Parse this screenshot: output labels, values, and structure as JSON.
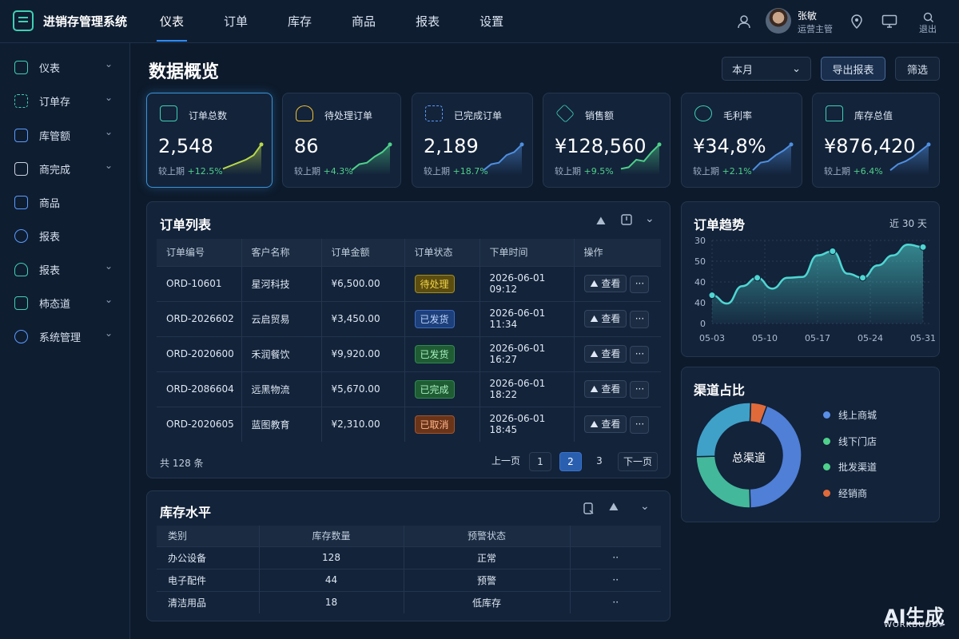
{
  "app": {
    "title": "进销存管理系统"
  },
  "nav": [
    "仪表",
    "订单",
    "库存",
    "商品",
    "报表",
    "设置"
  ],
  "user": {
    "name": "张敏",
    "role": "运营主管",
    "logout": "退出"
  },
  "sidebar": [
    {
      "label": "仪表",
      "chevron": true
    },
    {
      "label": "订单存",
      "chevron": true
    },
    {
      "label": "库管额",
      "chevron": true
    },
    {
      "label": "商完成",
      "chevron": true
    },
    {
      "label": "商品",
      "chevron": false
    },
    {
      "label": "报表",
      "chevron": false
    },
    {
      "label": "报表",
      "chevron": true
    },
    {
      "label": "柿态道",
      "chevron": true
    },
    {
      "label": "系统管理",
      "chevron": true
    }
  ],
  "page": {
    "title": "数据概览",
    "period": "本月",
    "export": "导出报表",
    "filter": "筛选"
  },
  "cards": [
    {
      "label": "订单总数",
      "value": "2,548",
      "compare": "较上期",
      "delta": "+12.5%",
      "color": "#3fd0b4",
      "spark": "#b8d94a"
    },
    {
      "label": "待处理订单",
      "value": "86",
      "compare": "较上期",
      "delta": "+4.3%",
      "color": "#f1c232",
      "spark": "#4fd18b"
    },
    {
      "label": "已完成订单",
      "value": "2,189",
      "compare": "较上期",
      "delta": "+18.7%",
      "color": "#5a9cff",
      "spark": "#4f8fe0"
    },
    {
      "label": "销售额",
      "value": "¥128,560",
      "compare": "较上期",
      "delta": "+9.5%",
      "color": "#3fd0b4",
      "spark": "#4fd18b"
    },
    {
      "label": "毛利率",
      "value": "¥34,8%",
      "compare": "较上期",
      "delta": "+2.1%",
      "color": "#3fd0b4",
      "spark": "#4f8fe0"
    },
    {
      "label": "库存总值",
      "value": "¥876,420",
      "compare": "较上期",
      "delta": "+6.4%",
      "color": "#3fd0b4",
      "spark": "#4f8fe0"
    }
  ],
  "orders": {
    "title": "订单列表",
    "columns": [
      "订单编号",
      "客户名称",
      "订单金额",
      "订单状态",
      "下单时间",
      "操作"
    ],
    "rows": [
      {
        "id": "ORD-10601",
        "customer": "星河科技",
        "amount": "¥6,500.00",
        "status": "待处理",
        "tone": "yellow",
        "time": "2026-06-01 09:12"
      },
      {
        "id": "ORD-2026602",
        "customer": "云启贸易",
        "amount": "¥3,450.00",
        "status": "已发货",
        "tone": "blue",
        "time": "2026-06-01 11:34"
      },
      {
        "id": "ORD-2020600",
        "customer": "禾润餐饮",
        "amount": "¥9,920.00",
        "status": "已发货",
        "tone": "green",
        "time": "2026-06-01 16:27"
      },
      {
        "id": "ORD-2086604",
        "customer": "远黑物流",
        "amount": "¥5,670.00",
        "status": "已完成",
        "tone": "green",
        "time": "2026-06-01 18:22"
      },
      {
        "id": "ORD-2020605",
        "customer": "蓝图教育",
        "amount": "¥2,310.00",
        "status": "已取消",
        "tone": "orange",
        "time": "2026-06-01 18:45"
      }
    ],
    "view": "查看",
    "more": "···",
    "total": "共 128 条",
    "pager": {
      "prev": "上一页",
      "pages": [
        "1",
        "2",
        "3"
      ],
      "current": "2",
      "next": "下一页"
    }
  },
  "inventory": {
    "title": "库存水平",
    "columns": [
      "类别",
      "库存数量",
      "预警状态",
      ""
    ],
    "rows": [
      {
        "category": "办公设备",
        "qty": "128",
        "status": "正常",
        "warn": false,
        "extra": "··"
      },
      {
        "category": "电子配件",
        "qty": "44",
        "status": "预警",
        "warn": true,
        "extra": "··"
      },
      {
        "category": "清洁用品",
        "qty": "18",
        "status": "低库存",
        "warn": true,
        "extra": "··"
      }
    ]
  },
  "trend": {
    "title": "订单趋势",
    "range": "近 30 天"
  },
  "chart_data": [
    {
      "type": "area",
      "title": "订单趋势",
      "x": [
        "05-03",
        "05-05",
        "05-08",
        "05-10",
        "05-12",
        "05-14",
        "05-16",
        "05-18",
        "05-20",
        "05-22",
        "05-24",
        "05-26",
        "05-28",
        "05-30",
        "05-31"
      ],
      "xticks": [
        "05-03",
        "05-10",
        "05-17",
        "05-24",
        "05-31"
      ],
      "yticks": [
        "0",
        "40",
        "40",
        "50",
        "30"
      ],
      "values": [
        0.34,
        0.24,
        0.45,
        0.55,
        0.42,
        0.55,
        0.56,
        0.82,
        0.87,
        0.6,
        0.55,
        0.7,
        0.82,
        0.95,
        0.92
      ],
      "markers": [
        0,
        3,
        8,
        10,
        14
      ],
      "color": "#4fd6d2"
    },
    {
      "type": "pie",
      "title": "渠道占比",
      "center": "总渠道",
      "slices": [
        {
          "name": "线上商城",
          "value": 44,
          "color": "#4f7fd6"
        },
        {
          "name": "线下门店",
          "value": 25,
          "color": "#43b89b"
        },
        {
          "name": "批发渠道",
          "value": 26,
          "color": "#3fa1c8"
        },
        {
          "name": "经销商",
          "value": 5,
          "color": "#e06a3a"
        }
      ],
      "legend": [
        "线上商城",
        "线下门店",
        "批发渠道",
        "经销商"
      ],
      "legend_colors": [
        "#5a8fe8",
        "#4fd18b",
        "#4fd18b",
        "#e06a3a"
      ]
    }
  ],
  "watermark": {
    "main": "AI生成",
    "sub": "WORKBUDD>"
  }
}
